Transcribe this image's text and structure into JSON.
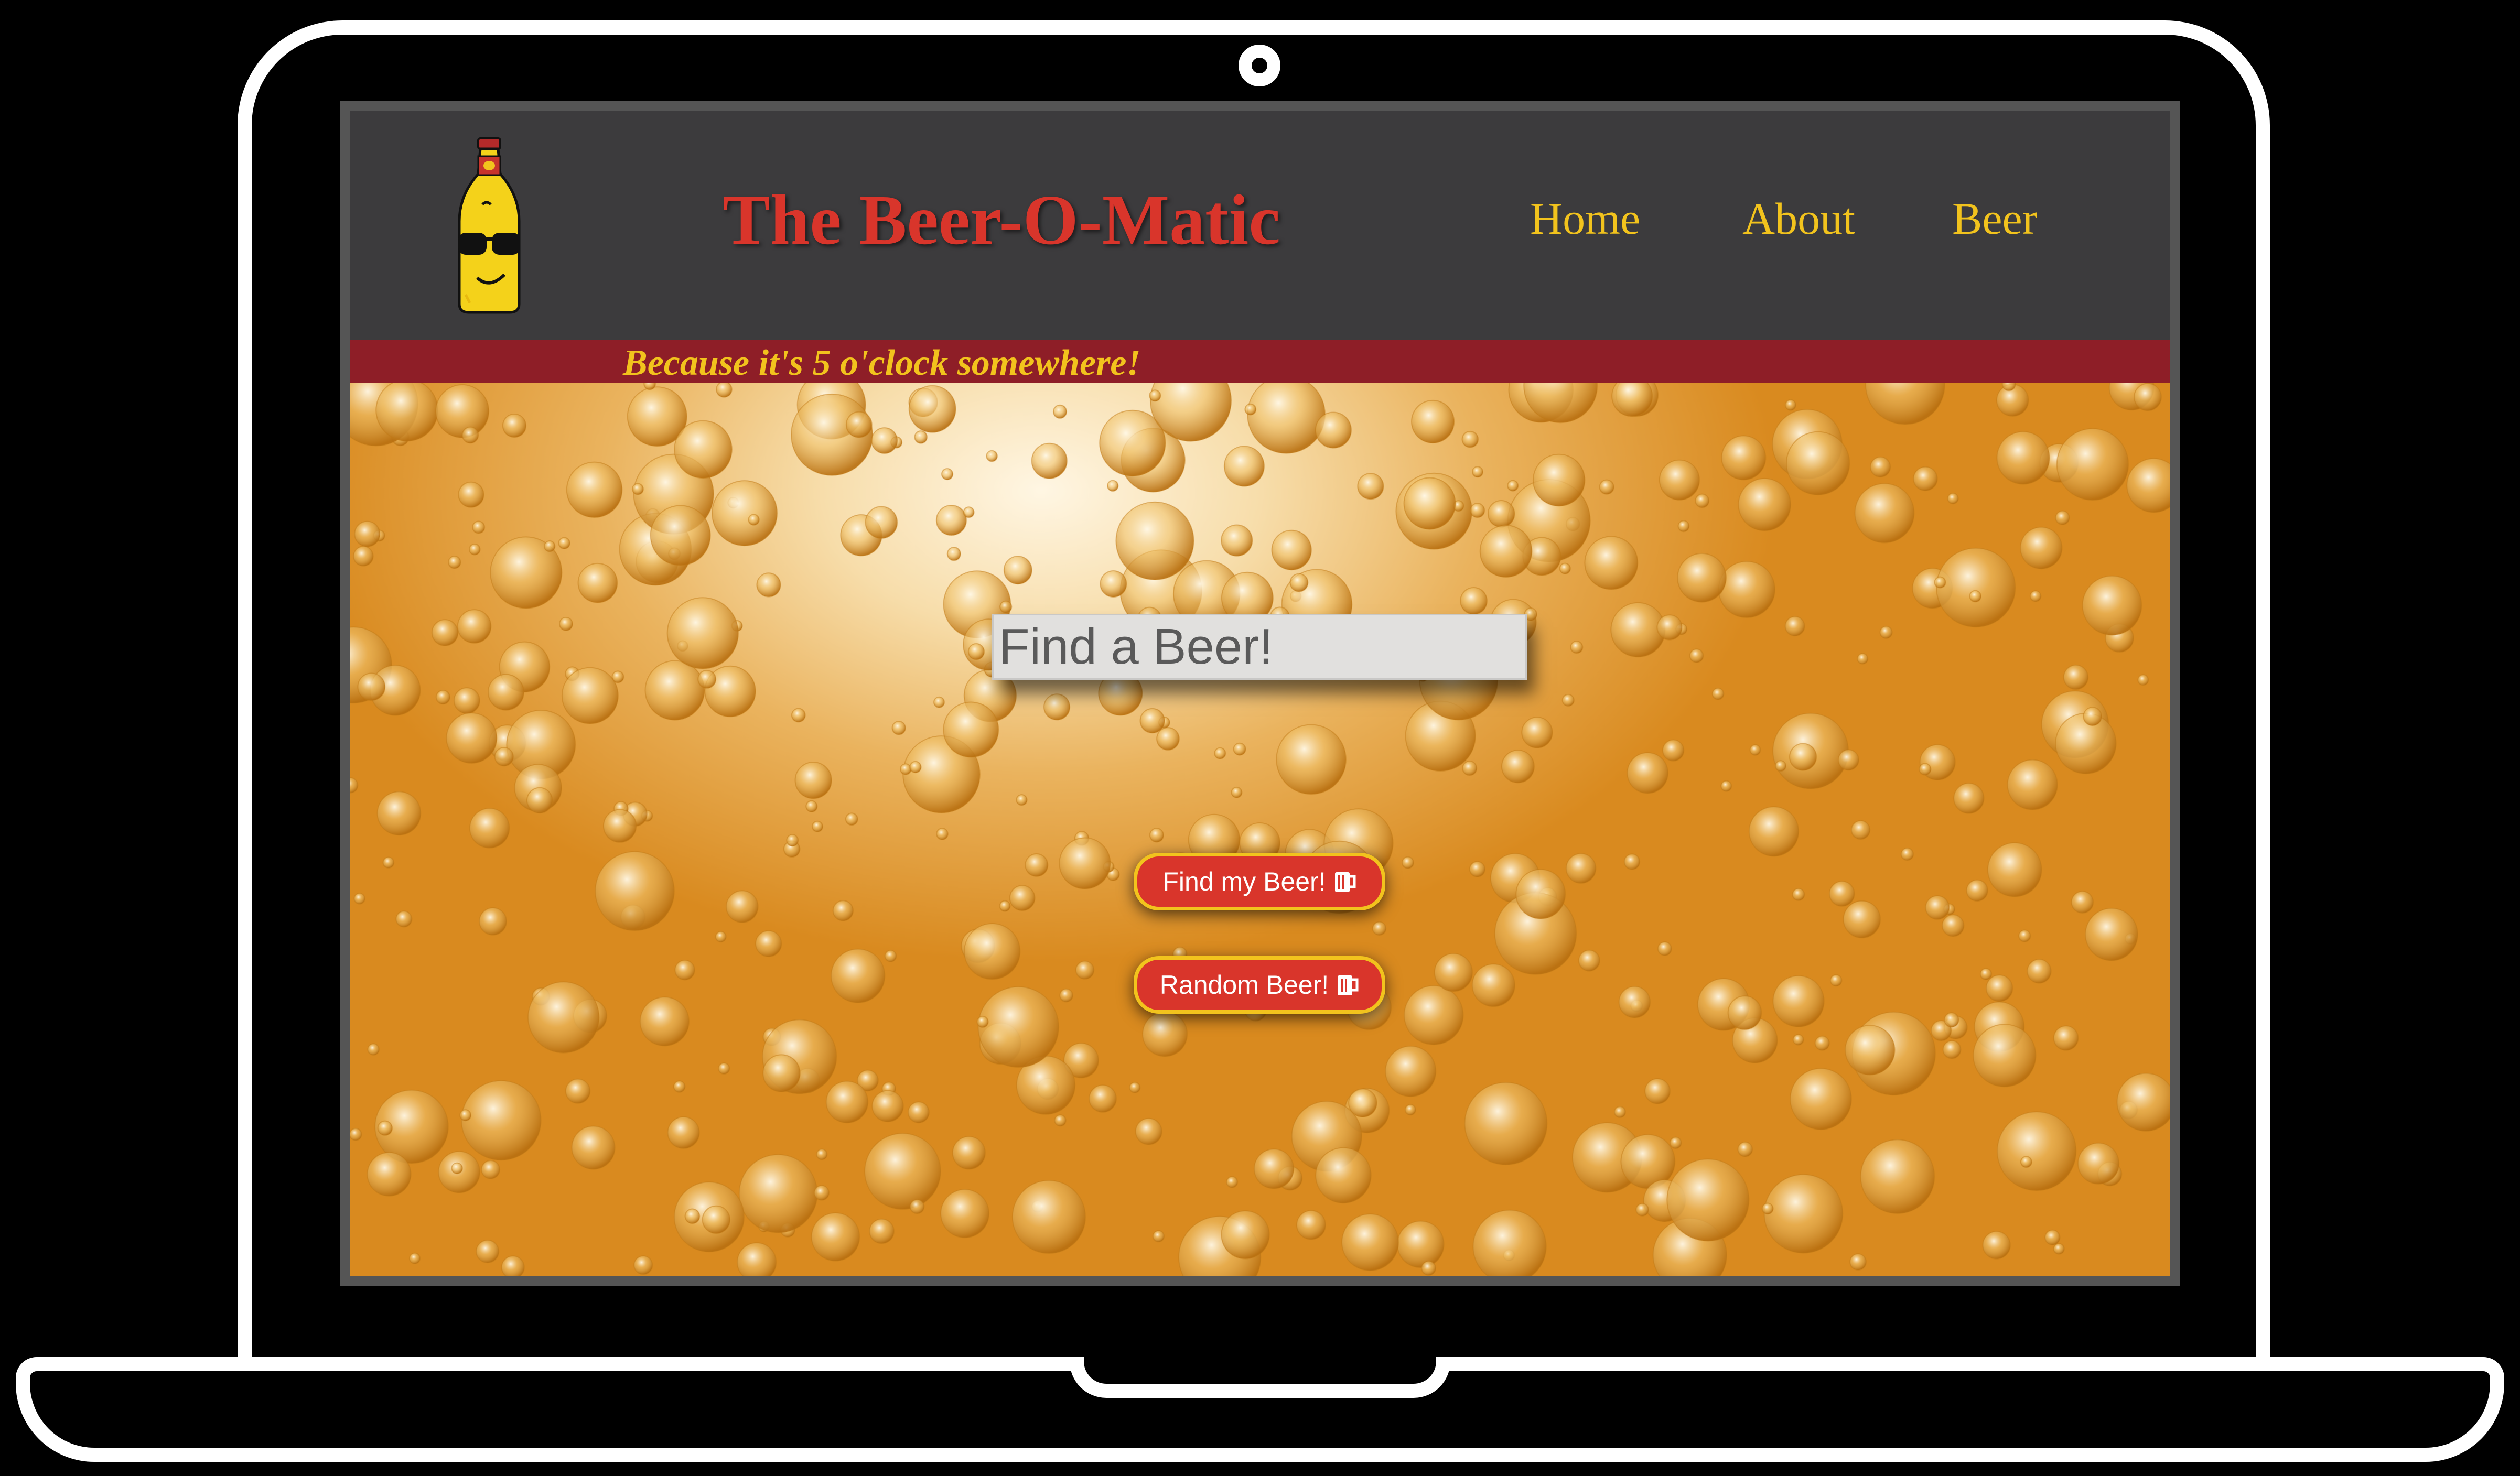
{
  "site": {
    "title": "The Beer-O-Matic",
    "tagline": "Because it's 5 o'clock somewhere!",
    "logo_icon": "beer-bottle-mascot-icon"
  },
  "nav": {
    "items": [
      {
        "label": "Home"
      },
      {
        "label": "About"
      },
      {
        "label": "Beer"
      }
    ]
  },
  "search": {
    "placeholder": "Find a Beer!",
    "value": ""
  },
  "buttons": {
    "find_label": "Find my Beer!",
    "random_label": "Random Beer!",
    "icon": "beer-mug-icon"
  },
  "colors": {
    "header_bg": "#3c3b3d",
    "title": "#d9352b",
    "nav_text": "#f2c31d",
    "tagline_bar": "#8e1e27",
    "button_bg": "#d9352b",
    "button_border": "#f2c31d"
  }
}
